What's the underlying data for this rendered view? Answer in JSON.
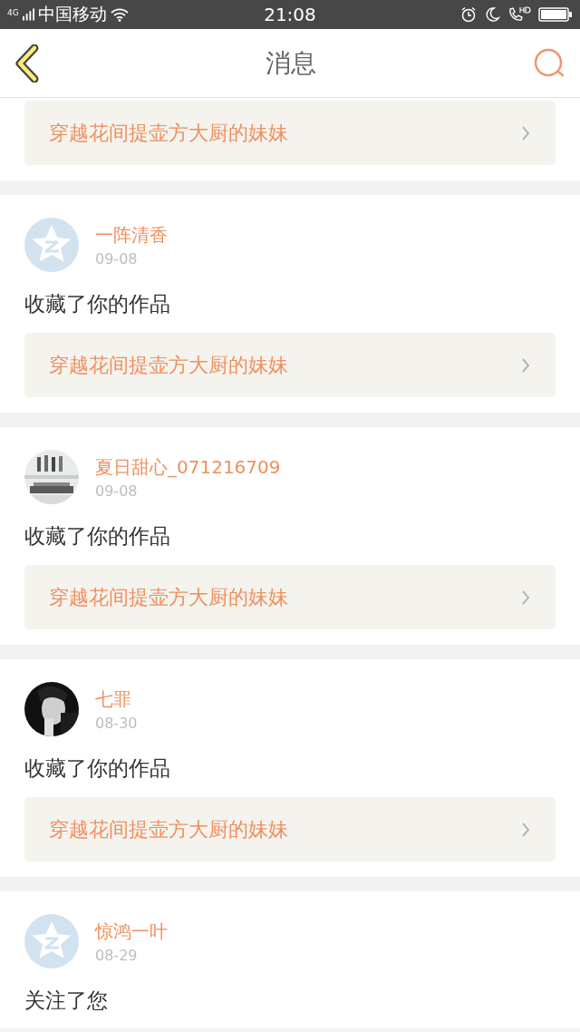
{
  "status_bar": {
    "network": "4G",
    "carrier": "中国移动",
    "time": "21:08"
  },
  "header": {
    "title": "消息"
  },
  "messages": [
    {
      "kind": "link_only",
      "link": "穿越花间提壶方大厨的妹妹"
    },
    {
      "kind": "message",
      "avatar": {
        "kind": "default"
      },
      "name": "一阵清香",
      "date": "09-08",
      "action": "收藏了你的作品",
      "link": "穿越花间提壶方大厨的妹妹"
    },
    {
      "kind": "message",
      "name": "夏日甜心_071216709",
      "date": "09-08",
      "action": "收藏了你的作品",
      "link": "穿越花间提壶方大厨的妹妹"
    },
    {
      "kind": "message",
      "avatar": {
        "kind": "dark"
      },
      "name": "七罪",
      "date": "08-30",
      "action": "收藏了你的作品",
      "link": "穿越花间提壶方大厨的妹妹"
    },
    {
      "kind": "message",
      "avatar": {
        "kind": "default"
      },
      "name": "惊鸿一叶",
      "date": "08-29",
      "action": "关注了您"
    }
  ]
}
